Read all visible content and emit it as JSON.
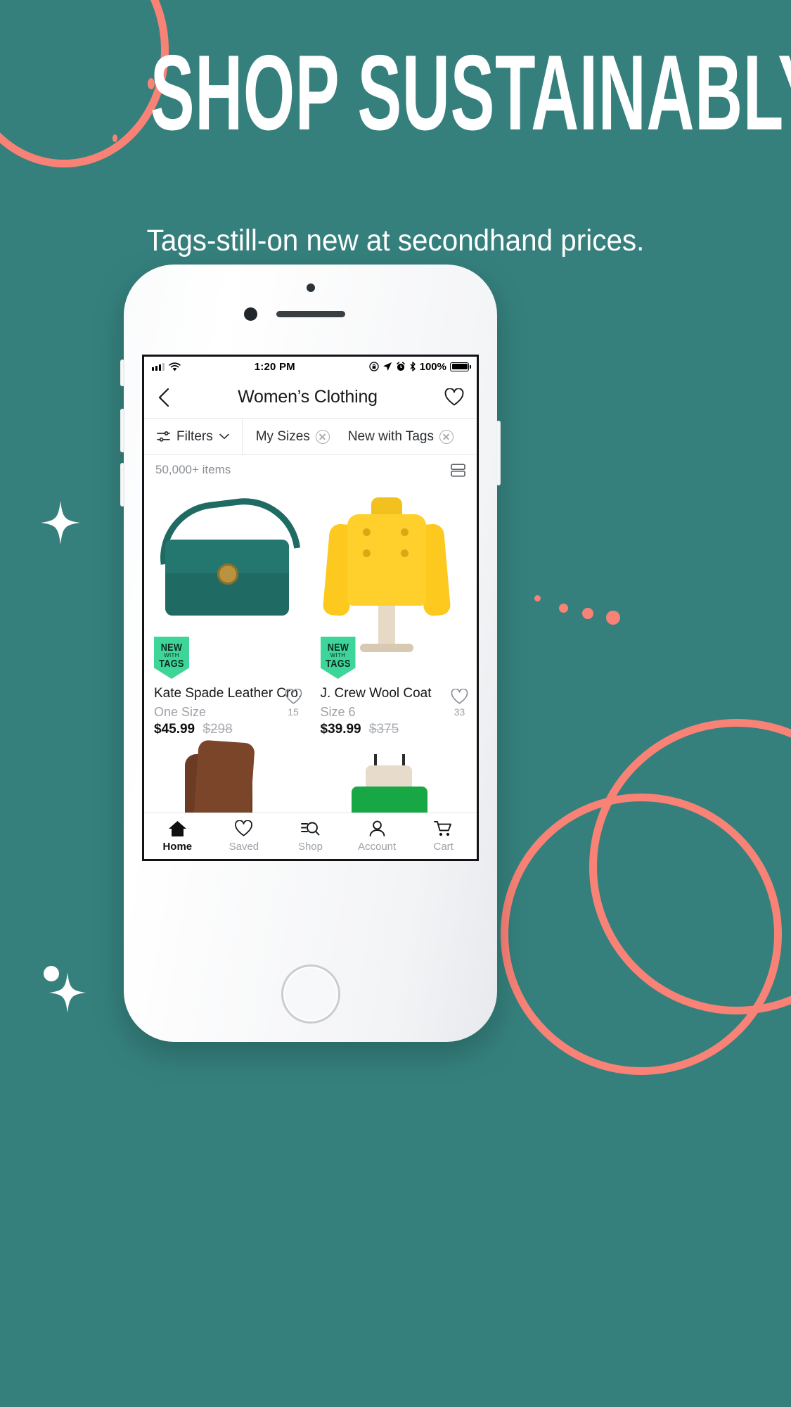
{
  "theme": {
    "background": "#35807D",
    "accent_coral": "#F98276",
    "badge_green": "#3ED598",
    "text_light": "#FFFFFF"
  },
  "hero": {
    "headline": "SHOP SUSTAINABLY",
    "subhead": "Tags-still-on new at secondhand prices."
  },
  "phone": {
    "statusbar": {
      "time": "1:20 PM",
      "battery_percent": "100%",
      "icons": [
        "signal-bars-icon",
        "wifi-icon",
        "rotation-lock-icon",
        "location-arrow-icon",
        "alarm-clock-icon",
        "bluetooth-icon",
        "battery-icon"
      ]
    },
    "navbar": {
      "back_icon": "chevron-left-icon",
      "title": "Women’s Clothing",
      "favorite_icon": "heart-icon"
    },
    "filterbar": {
      "filters_label": "Filters",
      "filters_icon": "sliders-icon",
      "chevron_icon": "chevron-down-icon",
      "chips": [
        {
          "label": "My Sizes",
          "remove_icon": "close-circle-icon"
        },
        {
          "label": "New with Tags",
          "remove_icon": "close-circle-icon"
        }
      ]
    },
    "results": {
      "count": "50,000+ items",
      "layout_toggle_icon": "list-view-icon"
    },
    "products": [
      {
        "title": "Kate Spade Leather Cro...",
        "size": "One Size",
        "price": "$45.99",
        "original_price": "$298",
        "likes": "15",
        "badge_line1": "NEW",
        "badge_line2": "WITH",
        "badge_line3": "TAGS",
        "art": "handbag-teal"
      },
      {
        "title": "J. Crew Wool Coat",
        "size": "Size 6",
        "price": "$39.99",
        "original_price": "$375",
        "likes": "33",
        "badge_line1": "NEW",
        "badge_line2": "WITH",
        "badge_line3": "TAGS",
        "art": "coat-yellow"
      },
      {
        "art": "boot-brown"
      },
      {
        "art": "dress-green"
      }
    ],
    "tabbar": [
      {
        "label": "Home",
        "icon": "home-icon",
        "active": true
      },
      {
        "label": "Saved",
        "icon": "heart-icon",
        "active": false
      },
      {
        "label": "Shop",
        "icon": "search-list-icon",
        "active": false
      },
      {
        "label": "Account",
        "icon": "person-icon",
        "active": false
      },
      {
        "label": "Cart",
        "icon": "cart-icon",
        "active": false
      }
    ]
  }
}
